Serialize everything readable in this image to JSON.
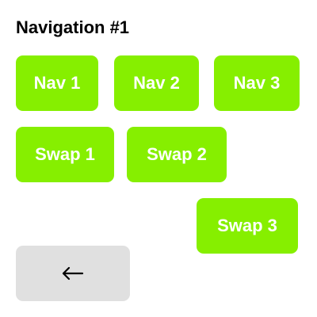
{
  "header": {
    "title": "Navigation #1"
  },
  "nav": {
    "buttons": [
      {
        "label": "Nav 1"
      },
      {
        "label": "Nav 2"
      },
      {
        "label": "Nav 3"
      }
    ]
  },
  "swap": {
    "buttons": [
      {
        "label": "Swap 1"
      },
      {
        "label": "Swap 2"
      },
      {
        "label": "Swap 3"
      }
    ]
  },
  "back_button": {
    "icon": "arrow-left-icon"
  },
  "colors": {
    "accent": "#86ef00",
    "button_text": "#ffffff",
    "back_button_bg": "#e0e0e0",
    "title": "#000000"
  }
}
